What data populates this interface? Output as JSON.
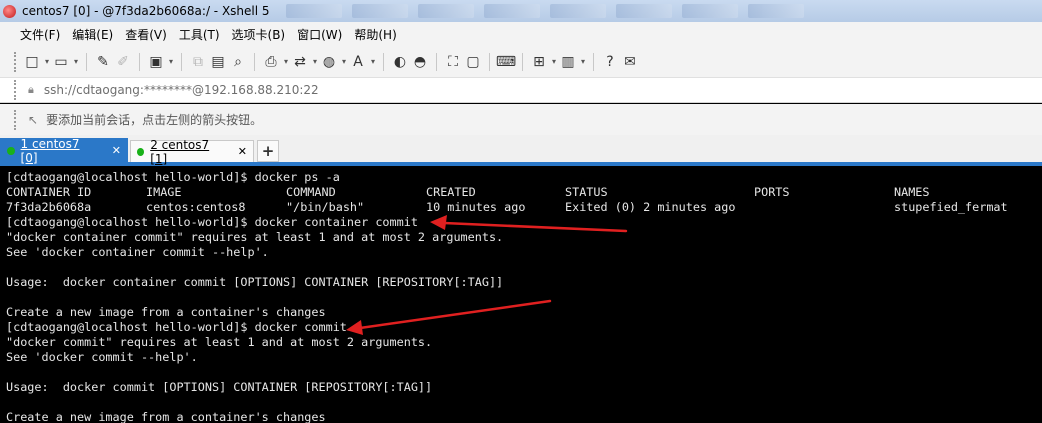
{
  "window": {
    "title": "centos7 [0] - @7f3da2b6068a:/ - Xshell 5"
  },
  "menu": [
    "文件(F)",
    "编辑(E)",
    "查看(V)",
    "工具(T)",
    "选项卡(B)",
    "窗口(W)",
    "帮助(H)"
  ],
  "address": {
    "text": "ssh://cdtaogang:********@192.168.88.210:22"
  },
  "hint": {
    "text": "要添加当前会话，点击左侧的箭头按钮。"
  },
  "tabs": [
    {
      "label": "1 centos7 [0]",
      "active": true,
      "close": "✕"
    },
    {
      "label": "2 centos7 [1]",
      "active": false,
      "close": "✕"
    }
  ],
  "tab_add": "+",
  "terminal": {
    "lines": [
      "[cdtaogang@localhost hello-world]$ docker ps -a",
      "",
      "",
      "[cdtaogang@localhost hello-world]$ docker container commit",
      "\"docker container commit\" requires at least 1 and at most 2 arguments.",
      "See 'docker container commit --help'.",
      "",
      "Usage:  docker container commit [OPTIONS] CONTAINER [REPOSITORY[:TAG]]",
      "",
      "Create a new image from a container's changes",
      "[cdtaogang@localhost hello-world]$ docker commit",
      "\"docker commit\" requires at least 1 and at most 2 arguments.",
      "See 'docker commit --help'.",
      "",
      "Usage:  docker commit [OPTIONS] CONTAINER [REPOSITORY[:TAG]]",
      "",
      "Create a new image from a container's changes"
    ],
    "ps_table": {
      "headers": [
        "CONTAINER ID",
        "IMAGE",
        "COMMAND",
        "CREATED",
        "STATUS",
        "PORTS",
        "NAMES"
      ],
      "row": [
        "7f3da2b6068a",
        "centos:centos8",
        "\"/bin/bash\"",
        "10 minutes ago",
        "Exited (0) 2 minutes ago",
        "",
        "stupefied_fermat"
      ]
    }
  },
  "colors": {
    "tab_active": "#2b78c8",
    "terminal_bg": "#000000",
    "terminal_fg": "#e6e6e6",
    "arrow": "#e02020"
  }
}
